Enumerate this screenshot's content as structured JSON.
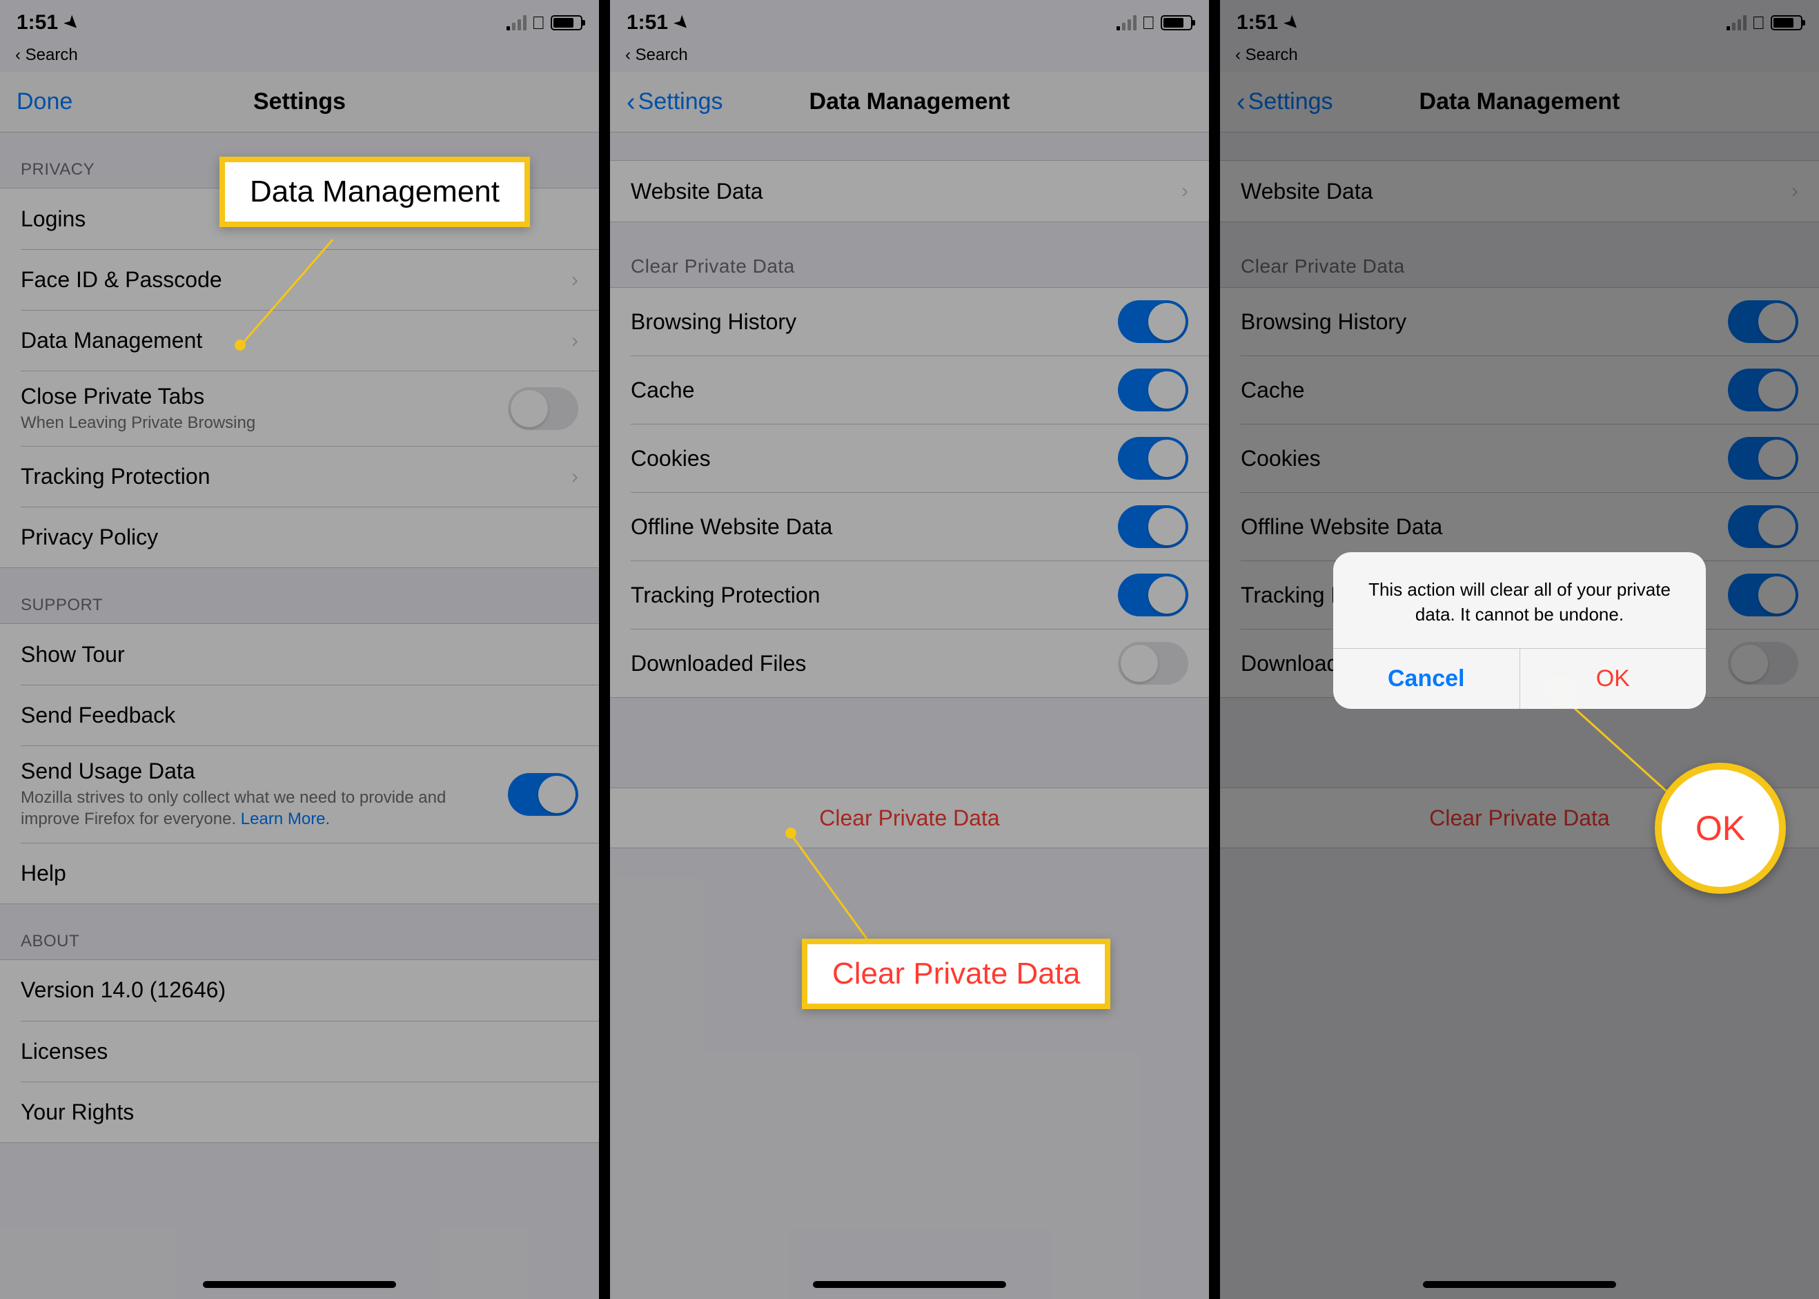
{
  "statusbar": {
    "time": "1:51",
    "back": "Search"
  },
  "panel1": {
    "nav": {
      "done": "Done",
      "title": "Settings"
    },
    "sections": {
      "privacy_header": "PRIVACY",
      "logins": "Logins",
      "faceid": "Face ID & Passcode",
      "data_mgmt": "Data Management",
      "close_tabs": "Close Private Tabs",
      "close_tabs_sub": "When Leaving Private Browsing",
      "tracking": "Tracking Protection",
      "privacy_policy": "Privacy Policy",
      "support_header": "SUPPORT",
      "show_tour": "Show Tour",
      "send_feedback": "Send Feedback",
      "send_usage": "Send Usage Data",
      "send_usage_sub": "Mozilla strives to only collect what we need to provide and improve Firefox for everyone. ",
      "learn_more": "Learn More.",
      "help": "Help",
      "about_header": "ABOUT",
      "version": "Version 14.0 (12646)",
      "licenses": "Licenses",
      "your_rights": "Your Rights"
    },
    "callout": "Data Management"
  },
  "panel2": {
    "nav": {
      "back": "Settings",
      "title": "Data Management"
    },
    "website_data": "Website Data",
    "clear_header": "Clear Private Data",
    "toggles": {
      "browsing": "Browsing History",
      "cache": "Cache",
      "cookies": "Cookies",
      "offline": "Offline Website Data",
      "tracking": "Tracking Protection",
      "downloads": "Downloaded Files"
    },
    "clear_button": "Clear Private Data",
    "callout": "Clear Private Data"
  },
  "panel3": {
    "nav": {
      "back": "Settings",
      "title": "Data Management"
    },
    "website_data": "Website Data",
    "clear_header": "Clear Private Data",
    "toggles": {
      "browsing": "Browsing History",
      "cache": "Cache",
      "cookies": "Cookies",
      "offline": "Offline Website Data",
      "tracking": "Tracking Protection",
      "downloads": "Downloaded Files"
    },
    "clear_button": "Clear Private Data",
    "alert": {
      "message": "This action will clear all of your private data. It cannot be undone.",
      "cancel": "Cancel",
      "ok": "OK"
    },
    "callout": "OK"
  }
}
